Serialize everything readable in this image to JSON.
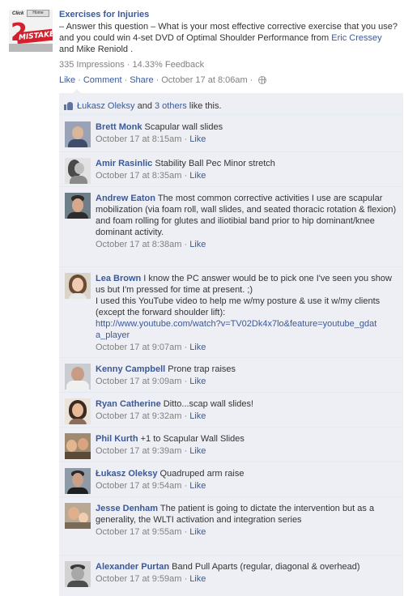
{
  "post": {
    "page_logo_texts": {
      "top_left": "Click",
      "top_right": "Home",
      "number": "2",
      "banner": "MISTAKES"
    },
    "page_name": "Exercises for Injuries",
    "text_before": "– Answer this question – What is your most effective corrective exercise that you use? and you could win 4-set DVD of Optimal Shoulder Performance from ",
    "link_1": "Eric Cressey",
    "text_middle": " and ",
    "text_name_2": "Mike Reniold",
    "text_after": " .",
    "impressions": "335 Impressions",
    "stats_sep": " · ",
    "feedback": "14.33% Feedback",
    "actions": {
      "like": "Like",
      "comment": "Comment",
      "share": "Share",
      "sep": "·",
      "timestamp": "October 17 at 8:06am",
      "privacy_icon": "globe-icon"
    }
  },
  "likes": {
    "icon": "thumbs-up-icon",
    "liker": "Łukasz Oleksy",
    "and_text": " and ",
    "others": "3 others",
    "suffix": " like this."
  },
  "comments": [
    {
      "author": "Brett Monk",
      "text": "Scapular wall slides",
      "link": "",
      "time": "October 17 at 8:15am",
      "like": "Like"
    },
    {
      "author": "Amir Rasinlic",
      "text": "Stability Ball Pec Minor stretch",
      "link": "",
      "time": "October 17 at 8:35am",
      "like": "Like"
    },
    {
      "author": "Andrew Eaton",
      "text": "The most common corrective activities I use are scapular mobilization (via foam roll, wall slides, and seated thoracic rotation & flexion) and foam rolling for glutes and iliotibial band prior to hip dominant/knee dominant activity.",
      "link": "",
      "time": "October 17 at 8:38am",
      "like": "Like"
    },
    {
      "author": "Lea Brown",
      "text": "I know the PC answer would be to pick one I've seen you show us but I'm pressed for time at present. ;)\nI used this YouTube video to help me w/my posture & use it w/my clients (except the forward shoulder lift):",
      "link": "http://www.youtube.com/watch?v=TV02Dk4x7lo&feature=youtube_gdata_player",
      "time": "October 17 at 9:07am",
      "like": "Like"
    },
    {
      "author": "Kenny Campbell",
      "text": "Prone trap raises",
      "link": "",
      "time": "October 17 at 9:09am",
      "like": "Like"
    },
    {
      "author": "Ryan Catherine",
      "text": "Ditto...scap wall slides!",
      "link": "",
      "time": "October 17 at 9:32am",
      "like": "Like"
    },
    {
      "author": "Phil Kurth",
      "text": "+1 to Scapular Wall Slides",
      "link": "",
      "time": "October 17 at 9:39am",
      "like": "Like"
    },
    {
      "author": "Łukasz Oleksy",
      "text": "Quadruped arm raise",
      "link": "",
      "time": "October 17 at 9:54am",
      "like": "Like"
    },
    {
      "author": "Jesse Denham",
      "text": "The patient is going to dictate the intervention but as a generality, the WLTI activation and integration series",
      "link": "",
      "time": "October 17 at 9:55am",
      "like": "Like"
    },
    {
      "author": "Alexander Purtan",
      "text": "Band Pull Aparts (regular, diagonal & overhead)",
      "link": "",
      "time": "October 17 at 9:59am",
      "like": "Like"
    }
  ],
  "colors": {
    "link": "#3b5998",
    "muted": "#808080",
    "ufi_background": "#edeff4",
    "logo_red": "#d61f2c"
  }
}
